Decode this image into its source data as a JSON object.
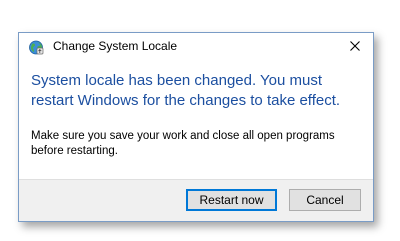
{
  "window": {
    "title": "Change System Locale",
    "app_icon": "globe-icon",
    "close_icon": "close-icon"
  },
  "message": {
    "main_instruction": "System locale has been changed. You must restart Windows for the changes to take effect.",
    "secondary": "Make sure you save your work and close all open programs before restarting."
  },
  "buttons": {
    "restart_label": "Restart now",
    "cancel_label": "Cancel"
  },
  "colors": {
    "main_instruction": "#1c4fa0",
    "primary_button_border": "#0078d7",
    "footer_background": "#f0f0f0"
  }
}
